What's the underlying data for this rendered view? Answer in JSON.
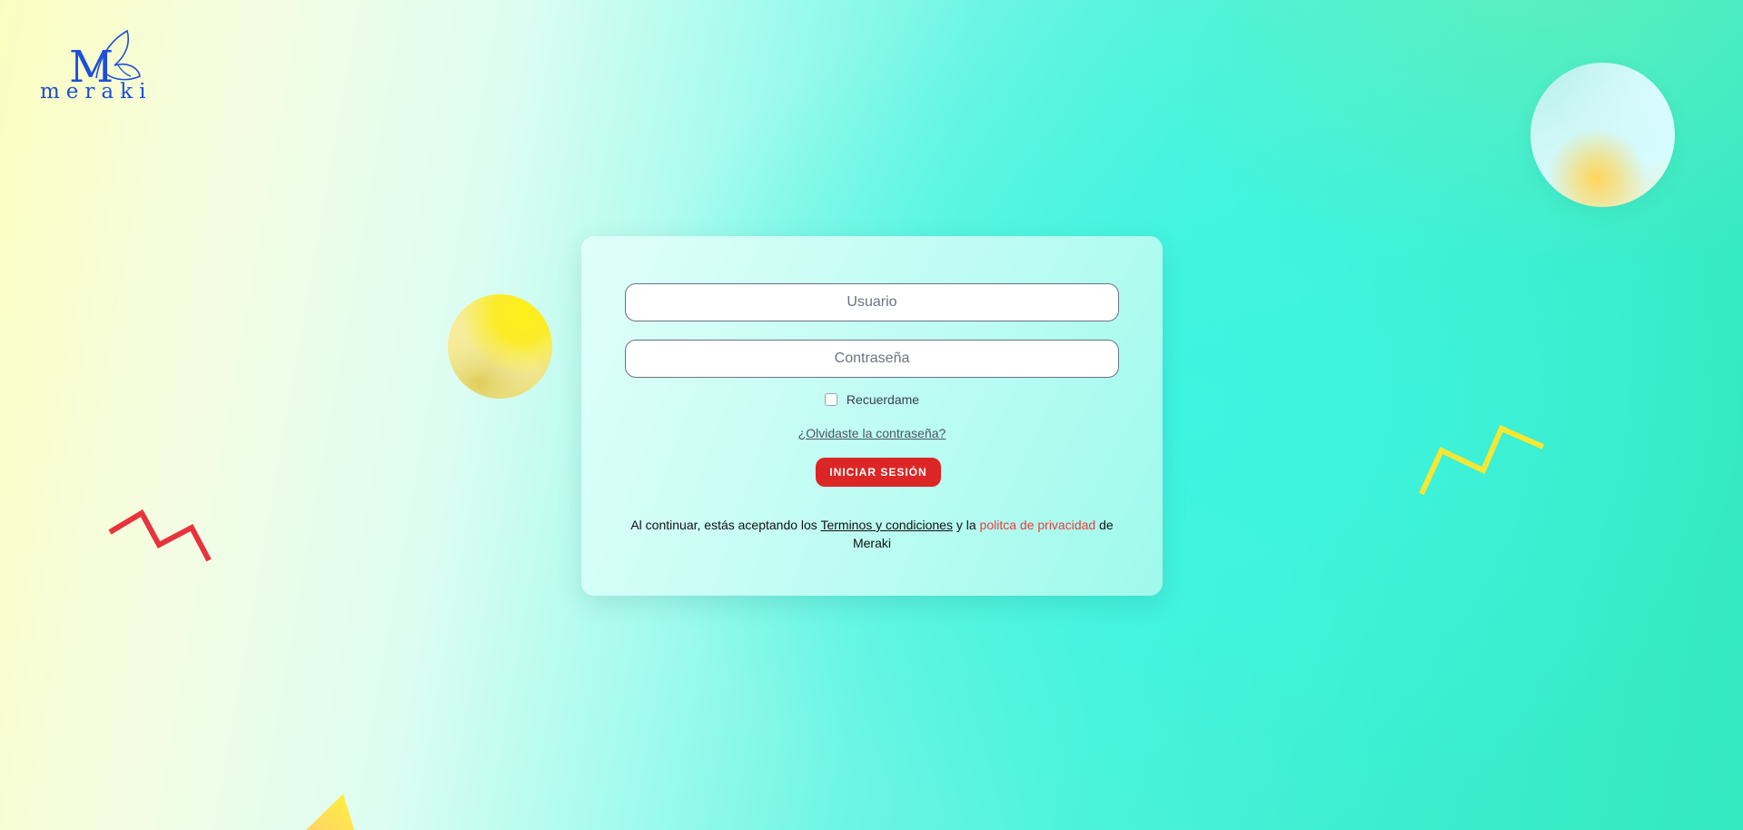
{
  "brand": {
    "name": "meraki",
    "logo_icon": "butterfly-m-monogram"
  },
  "form": {
    "username_placeholder": "Usuario",
    "password_placeholder": "Contraseña",
    "remember_label": "Recuerdame",
    "remember_checked": false,
    "forgot_link": "¿Olvidaste la contraseña?",
    "submit_label": "INICIAR SESIÓN"
  },
  "legal": {
    "prefix": "Al continuar, estás aceptando los ",
    "terms_link": "Terminos y condiciones",
    "middle": " y la ",
    "privacy_link": "politca de privacidad",
    "suffix": " de Meraki"
  },
  "colors": {
    "accent": "#dc2626",
    "privacy_link": "#ef3b3b",
    "logo": "#1d4fd8",
    "zigzag_red": "#e8333d",
    "zigzag_yellow": "#f7e733"
  }
}
